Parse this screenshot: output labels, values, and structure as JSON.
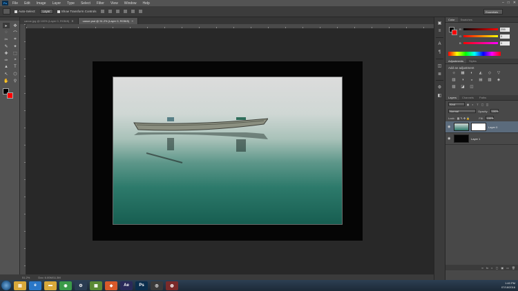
{
  "menubar": {
    "logo": "Ps",
    "items": [
      "File",
      "Edit",
      "Image",
      "Layer",
      "Type",
      "Select",
      "Filter",
      "View",
      "Window",
      "Help"
    ],
    "window_controls": [
      "–",
      "□",
      "✕"
    ]
  },
  "optionsbar": {
    "auto_select_label": "Auto-Select:",
    "auto_select_value": "Layer",
    "show_transform_label": "Show Transform Controls",
    "workspace": "Essentials"
  },
  "tabs": [
    {
      "label": "canoe.jpg @ 100% (Layer 0, RGB/8)",
      "active": false
    },
    {
      "label": "canoe.psd @ 51.2% (Layer 0, RGB/8)",
      "active": true
    }
  ],
  "statusbar": {
    "zoom": "51.2%",
    "doc_info": "Doc: 6.00M/11.3M"
  },
  "colors": {
    "foreground": "#000000",
    "background": "#ff0000",
    "accent": "#31a8ff"
  },
  "color_panel": {
    "tabs": [
      "Color",
      "Swatches"
    ],
    "sliders": [
      {
        "label": "R",
        "value": "255"
      },
      {
        "label": "G",
        "value": "0"
      },
      {
        "label": "B",
        "value": "0"
      }
    ]
  },
  "adjustments_panel": {
    "tabs": [
      "Adjustments",
      "Styles"
    ],
    "title": "Add an adjustment",
    "icons": [
      "☼",
      "▦",
      "◐",
      "◭",
      "◇",
      "▽",
      "▥",
      "◑",
      "◒",
      "▤",
      "▧",
      "◈",
      "▨",
      "◪",
      "◫"
    ]
  },
  "layers_panel": {
    "tabs": [
      "Layers",
      "Channels",
      "Paths"
    ],
    "filter_kind": "Kind",
    "blend_mode": "Normal",
    "opacity_label": "Opacity:",
    "opacity_value": "100%",
    "lock_label": "Lock:",
    "fill_label": "Fill:",
    "fill_value": "100%",
    "layers": [
      {
        "name": "Layer 0",
        "active": true
      },
      {
        "name": "Layer 1",
        "active": false
      }
    ],
    "footer_icons": [
      "∞",
      "fx",
      "◐",
      "▢",
      "▣",
      "▭",
      "🗑"
    ]
  },
  "tools": [
    "▸",
    "✥",
    "◌",
    "⌒",
    "✂",
    "⌗",
    "✎",
    "✦",
    "✚",
    "⬚",
    "✑",
    "◓",
    "▲",
    "T",
    "↖",
    "⬡",
    "✋",
    "⚲"
  ],
  "dock_icons": [
    "▣",
    "≡",
    "A",
    "¶",
    "◫",
    "≣",
    "⚙",
    "◧"
  ],
  "taskbar": {
    "apps": [
      {
        "name": "explorer-icon",
        "glyph": "▤",
        "color": "#d8a83a"
      },
      {
        "name": "ie-icon",
        "glyph": "e",
        "color": "#2a77c8"
      },
      {
        "name": "folder-icon",
        "glyph": "▬",
        "color": "#d8a83a"
      },
      {
        "name": "chrome-icon",
        "glyph": "◉",
        "color": "#3a9a49"
      },
      {
        "name": "steam-icon",
        "glyph": "⚙",
        "color": "#2a3c52"
      },
      {
        "name": "minecraft-icon",
        "glyph": "▦",
        "color": "#5a8a34"
      },
      {
        "name": "app-orange-icon",
        "glyph": "◆",
        "color": "#d85a2a"
      },
      {
        "name": "after-effects-icon",
        "glyph": "Ae",
        "color": "#2a2a5a"
      },
      {
        "name": "photoshop-icon",
        "glyph": "Ps",
        "color": "#0b2e4d"
      },
      {
        "name": "eye-icon",
        "glyph": "◎",
        "color": "#3a3a3a"
      },
      {
        "name": "recorder-icon",
        "glyph": "◍",
        "color": "#7a2a2a"
      }
    ],
    "time": "1:40 PM",
    "date": "07/18/2016"
  }
}
